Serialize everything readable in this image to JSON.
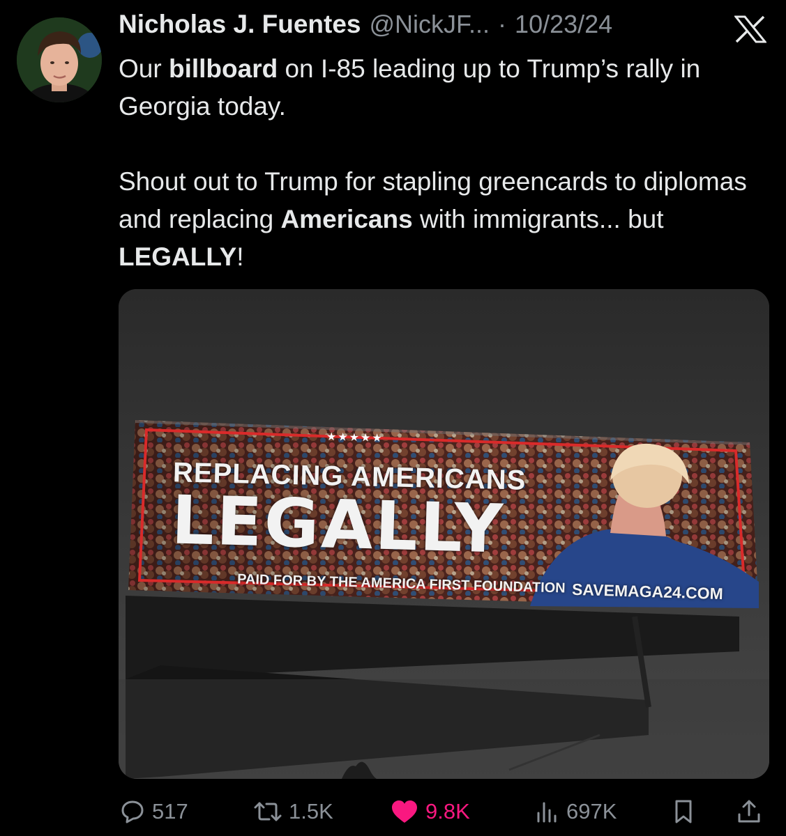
{
  "tweet": {
    "display_name": "Nicholas J. Fuentes",
    "handle": "@NickJF...",
    "separator": "·",
    "date": "10/23/24",
    "text": {
      "line1_pre": "Our ",
      "line1_bold": "billboard",
      "line1_post": " on I-85 leading up to Trump’s rally in Georgia today.",
      "para2_pre": "Shout out to Trump for stapling greencards to diplomas and replacing ",
      "para2_bold1": "Americans",
      "para2_mid": " with immigrants... but ",
      "para2_bold2": "LEGALLY",
      "para2_post": "!"
    }
  },
  "billboard": {
    "stars": "★★★★★",
    "headline": "REPLACING AMERICANS",
    "big_word": "LEGALLY",
    "paid_for": "PAID FOR BY THE AMERICA FIRST FOUNDATION",
    "url": "SAVEMAGA24.COM"
  },
  "actions": {
    "replies": "517",
    "retweets": "1.5K",
    "likes": "9.8K",
    "views": "697K"
  },
  "icons": {
    "platform": "x-logo-icon",
    "reply": "comment-icon",
    "retweet": "retweet-icon",
    "like": "heart-icon",
    "views": "views-chart-icon",
    "bookmark": "bookmark-icon",
    "share": "share-icon"
  },
  "colors": {
    "background": "#000000",
    "text": "#e7e9ea",
    "muted": "#8b9198",
    "like": "#f91880"
  }
}
